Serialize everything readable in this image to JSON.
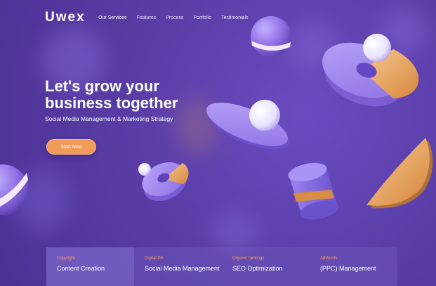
{
  "header": {
    "logo": "Uwex",
    "nav": [
      {
        "label": "Our Services"
      },
      {
        "label": "Features"
      },
      {
        "label": "Process"
      },
      {
        "label": "Portfolio"
      },
      {
        "label": "Testimonials"
      }
    ]
  },
  "hero": {
    "title": "Let's grow your business together",
    "subtitle": "Social Media Management  & Marketing Strategy",
    "cta_label": "Start Now"
  },
  "services": [
    {
      "kicker": "Copyright",
      "title": "Content Creation"
    },
    {
      "kicker": "Digital PR",
      "title": "Social Media Management"
    },
    {
      "kicker": "Organic rankings",
      "title": "SEO Optimization"
    },
    {
      "kicker": "AdWords",
      "title": "(PPC) Management"
    }
  ],
  "colors": {
    "background": "#5b3fa6",
    "accent": "#f29a57",
    "shape_purple": "#a58ff0",
    "shape_orange": "#e7a25b"
  }
}
